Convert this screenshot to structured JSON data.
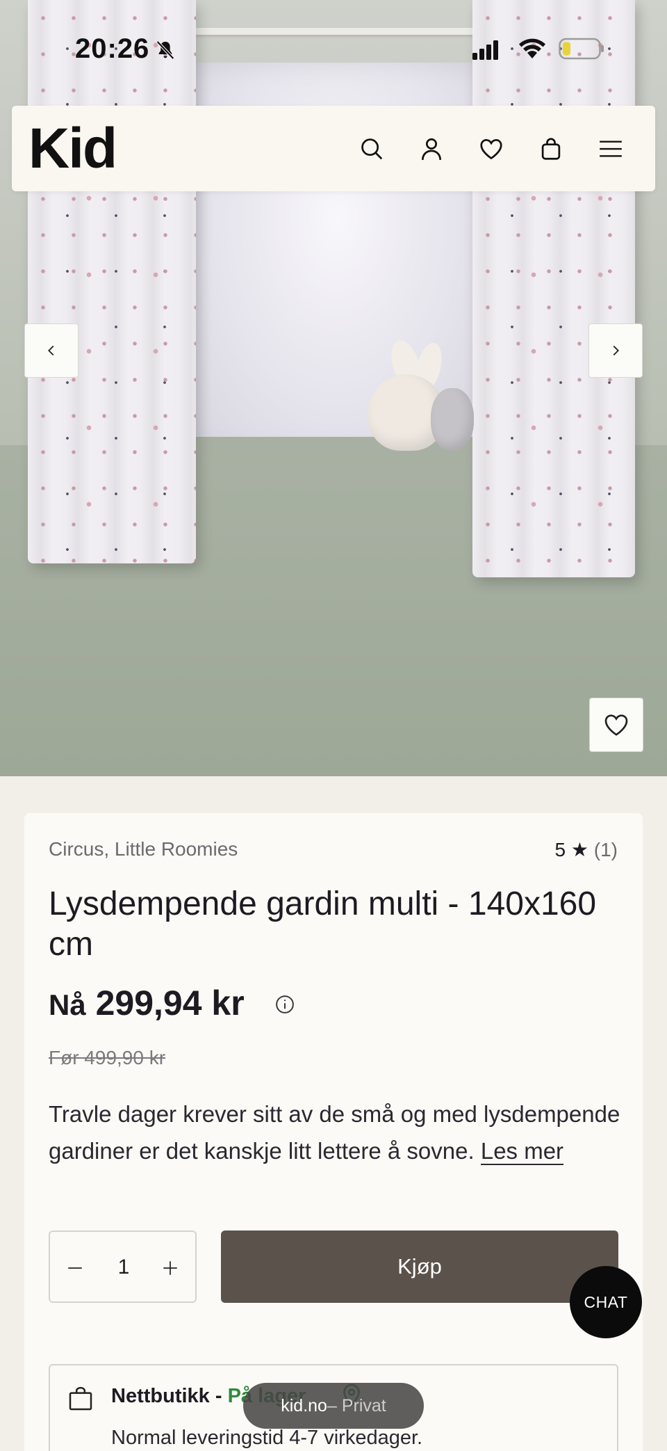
{
  "status_bar": {
    "time": "20:26"
  },
  "header": {
    "logo": "Kid",
    "icons": [
      "search-icon",
      "account-icon",
      "wishlist-heart-icon",
      "cart-bag-icon",
      "hamburger-menu-icon"
    ]
  },
  "gallery": {
    "prev_icon": "chevron-left-icon",
    "next_icon": "chevron-right-icon",
    "favorite_icon": "heart-icon"
  },
  "product": {
    "brand": "Circus, Little Roomies",
    "rating": {
      "score": "5 ★",
      "count": "(1)"
    },
    "title": "Lysdempende gardin multi - 140x160 cm",
    "price": {
      "prefix": "Nå",
      "amount": "299,94 kr"
    },
    "old_price": "Før 499,90 kr",
    "description": "Travle dager krever sitt av de små og med lysdempende gardiner er det kanskje litt lettere å sovne.",
    "read_more": "Les mer",
    "quantity": "1",
    "buy_label": "Kjøp"
  },
  "delivery": {
    "channel": "Nettbutikk - ",
    "stock": "På lager",
    "lead_time": "Normal leveringstid 4-7 virkedager."
  },
  "chat_label": "CHAT",
  "browser": {
    "domain": "kid.no",
    "mode": " – Privat"
  },
  "colors": {
    "buy_button": "#5b524c",
    "in_stock": "#2f8a3e",
    "header_bg": "#f9f7ef",
    "page_bg": "#f2efe9"
  }
}
